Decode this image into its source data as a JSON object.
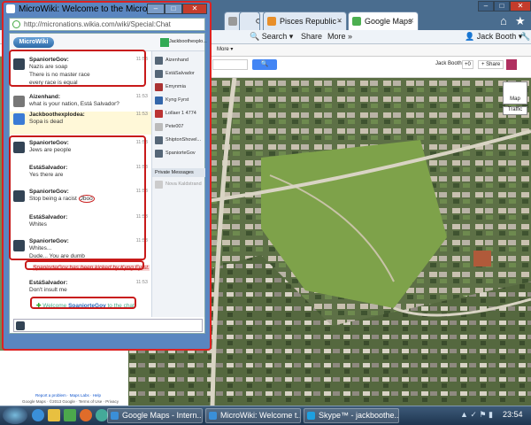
{
  "window": {
    "title": "MicroWiki: Welcome to the MicroWiki...",
    "url": "http://micronations.wikia.com/wiki/Special:Chat"
  },
  "chat": {
    "logo_text": "MicroWiki",
    "header_user": "Jackboothexplo...",
    "messages": [
      {
        "user": "SpaniorteGov:",
        "lines": [
          "Nazis are soap",
          "There is no master race",
          "every race is equal"
        ],
        "time": "11:53"
      },
      {
        "user": "Aizenhand:",
        "lines": [
          "what is your nation, Está Salvador?"
        ],
        "time": "11:53"
      },
      {
        "user": "Jackboothexplodea:",
        "lines": [
          "Sopa is dead"
        ],
        "time": "11:53"
      },
      {
        "user": "SpaniorteGov:",
        "lines": [
          "Jews are people"
        ],
        "time": "11:53"
      },
      {
        "user": "EstáSalvador:",
        "lines": [
          "Yes there are"
        ],
        "time": "11:53"
      },
      {
        "user": "SpaniorteGov:",
        "lines": [
          "Stop being a racist",
          "Jboo"
        ],
        "time": "11:53"
      },
      {
        "user": "EstáSalvador:",
        "lines": [
          "Whites"
        ],
        "time": "11:53"
      },
      {
        "user": "SpaniorteGov:",
        "lines": [
          "Whites...",
          "Dude... You are dumb"
        ],
        "time": "11:53"
      },
      {
        "user": "EstáSalvador:",
        "lines": [
          "Don't insult me"
        ],
        "time": "11:53"
      }
    ],
    "kick_notice": "SpaniorteGov has been kicked by Kyng Fyrst.",
    "welcome_prefix": "Welcome",
    "welcome_user": "SpaniorteGov",
    "welcome_suffix": "to the chat!",
    "users": [
      "Aizenhand",
      "EstáSalvador",
      "Emynmia",
      "Kyng Fyrst",
      "Lollaer 1 4774",
      "Pete007",
      "ShiptonShovel...",
      "SpaniorteGov"
    ],
    "private_header": "Private Messages",
    "private_user": "Nova Kaldstrand"
  },
  "browser": {
    "tabs": [
      "Pisces Republic -",
      "Google Maps"
    ],
    "toolbar": {
      "search": "Search",
      "share": "Share",
      "more": "More",
      "user": "Jack Booth"
    },
    "gbar": {
      "user": "Jack Booth",
      "plus": "+0",
      "share": "Share"
    },
    "map_controls": {
      "map": "Map",
      "traffic": "Traffic"
    },
    "footer_line1": "Report a problem · Maps Labs · Help",
    "footer_line2": "Google Maps · ©2013 Google · Terms of Use · Privacy",
    "more_link": "More"
  },
  "taskbar": {
    "apps": [
      "Google Maps - Intern...",
      "MicroWiki: Welcome t...",
      "Skype™ - jackboothe..."
    ],
    "clock": "23:54"
  },
  "colors": {
    "highlight": "#c81a1a",
    "title_bar": "#5a86c0"
  }
}
